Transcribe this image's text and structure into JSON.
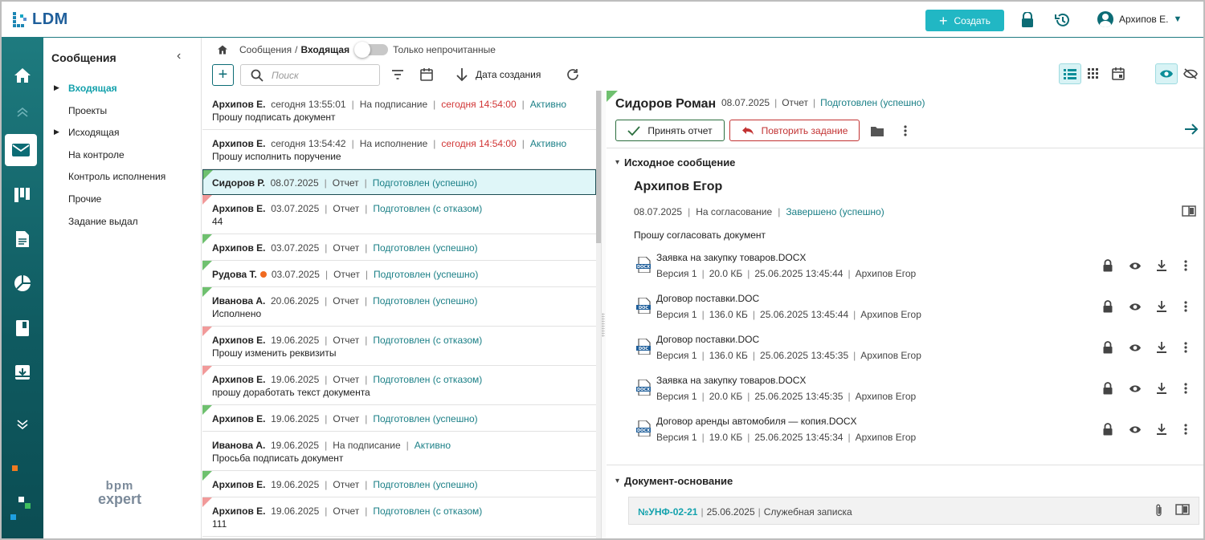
{
  "app": {
    "logo_text": "LDM"
  },
  "topbar": {
    "create_label": "Создать",
    "user_name": "Архипов Е."
  },
  "sidebar": {
    "title": "Сообщения",
    "items": [
      {
        "label": "Входящая",
        "active": true,
        "expandable": true
      },
      {
        "label": "Проекты"
      },
      {
        "label": "Исходящая",
        "expandable": true
      },
      {
        "label": "На контроле"
      },
      {
        "label": "Контроль исполнения"
      },
      {
        "label": "Прочие"
      },
      {
        "label": "Задание выдал"
      }
    ],
    "brand_line1": "bpm",
    "brand_line2": "expert"
  },
  "breadcrumb": {
    "root": "Сообщения",
    "separator": "/",
    "current": "Входящая",
    "toggle_label": "Только непрочитанные"
  },
  "toolbar": {
    "search_placeholder": "Поиск",
    "sort_label": "Дата создания"
  },
  "messages": [
    {
      "author": "Архипов Е.",
      "date": "сегодня 13:55:01",
      "type": "На подписание",
      "deadline": "сегодня 14:54:00",
      "status": "Активно",
      "text": "Прошу подписать документ"
    },
    {
      "author": "Архипов Е.",
      "date": "сегодня 13:54:42",
      "type": "На исполнение",
      "deadline": "сегодня 14:54:00",
      "status": "Активно",
      "text": "Прошу исполнить поручение"
    },
    {
      "author": "Сидоров Р.",
      "date": "08.07.2025",
      "type": "Отчет",
      "status": "Подготовлен (успешно)",
      "flag": "green",
      "selected": true
    },
    {
      "author": "Архипов Е.",
      "date": "03.07.2025",
      "type": "Отчет",
      "status": "Подготовлен (с отказом)",
      "text": "44",
      "flag": "red"
    },
    {
      "author": "Архипов Е.",
      "date": "03.07.2025",
      "type": "Отчет",
      "status": "Подготовлен (успешно)",
      "flag": "green"
    },
    {
      "author": "Рудова Т.",
      "date": "03.07.2025",
      "type": "Отчет",
      "status": "Подготовлен (успешно)",
      "flag": "green",
      "unread_dot": true
    },
    {
      "author": "Иванова А.",
      "date": "20.06.2025",
      "type": "Отчет",
      "status": "Подготовлен (успешно)",
      "text": "Исполнено",
      "flag": "green"
    },
    {
      "author": "Архипов Е.",
      "date": "19.06.2025",
      "type": "Отчет",
      "status": "Подготовлен (с отказом)",
      "text": "Прошу изменить реквизиты",
      "flag": "red"
    },
    {
      "author": "Архипов Е.",
      "date": "19.06.2025",
      "type": "Отчет",
      "status": "Подготовлен (с отказом)",
      "text": "прошу доработать текст документа",
      "flag": "red"
    },
    {
      "author": "Архипов Е.",
      "date": "19.06.2025",
      "type": "Отчет",
      "status": "Подготовлен (успешно)",
      "flag": "green"
    },
    {
      "author": "Иванова А.",
      "date": "19.06.2025",
      "type": "На подписание",
      "status": "Активно",
      "text": "Просьба подписать документ"
    },
    {
      "author": "Архипов Е.",
      "date": "19.06.2025",
      "type": "Отчет",
      "status": "Подготовлен (успешно)",
      "flag": "green"
    },
    {
      "author": "Архипов Е.",
      "date": "19.06.2025",
      "type": "Отчет",
      "status": "Подготовлен (с отказом)",
      "text": "111",
      "flag": "red"
    }
  ],
  "detail": {
    "name": "Сидоров Роман",
    "date": "08.07.2025",
    "type": "Отчет",
    "status": "Подготовлен (успешно)",
    "accept_label": "Принять отчет",
    "repeat_label": "Повторить задание",
    "source_section_title": "Исходное сообщение",
    "source": {
      "author": "Архипов Егор",
      "date": "08.07.2025",
      "type": "На согласование",
      "status": "Завершено (успешно)",
      "text": "Прошу согласовать документ"
    },
    "files": [
      {
        "name": "Заявка на закупку товаров.DOCX",
        "version": "Версия 1",
        "size": "20.0 КБ",
        "datetime": "25.06.2025 13:45:44",
        "author": "Архипов Егор",
        "ext": "DOCX"
      },
      {
        "name": "Договор поставки.DOC",
        "version": "Версия 1",
        "size": "136.0 КБ",
        "datetime": "25.06.2025 13:45:44",
        "author": "Архипов Егор",
        "ext": "DOC"
      },
      {
        "name": "Договор поставки.DOC",
        "version": "Версия 1",
        "size": "136.0 КБ",
        "datetime": "25.06.2025 13:45:35",
        "author": "Архипов Егор",
        "ext": "DOC"
      },
      {
        "name": "Заявка на закупку товаров.DOCX",
        "version": "Версия 1",
        "size": "20.0 КБ",
        "datetime": "25.06.2025 13:45:35",
        "author": "Архипов Егор",
        "ext": "DOCX"
      },
      {
        "name": "Договор аренды автомобиля — копия.DOCX",
        "version": "Версия 1",
        "size": "19.0 КБ",
        "datetime": "25.06.2025 13:45:34",
        "author": "Архипов Егор",
        "ext": "DOCX"
      }
    ],
    "base_section_title": "Документ-основание",
    "base_doc": {
      "number": "№УНФ-02-21",
      "date": "25.06.2025",
      "kind": "Служебная записка"
    }
  },
  "colors": {
    "accent": "#21b7c4",
    "primary": "#0c6c75",
    "danger": "#d13535",
    "success_flag": "#6fc06f",
    "reject_flag": "#f19a9a"
  }
}
